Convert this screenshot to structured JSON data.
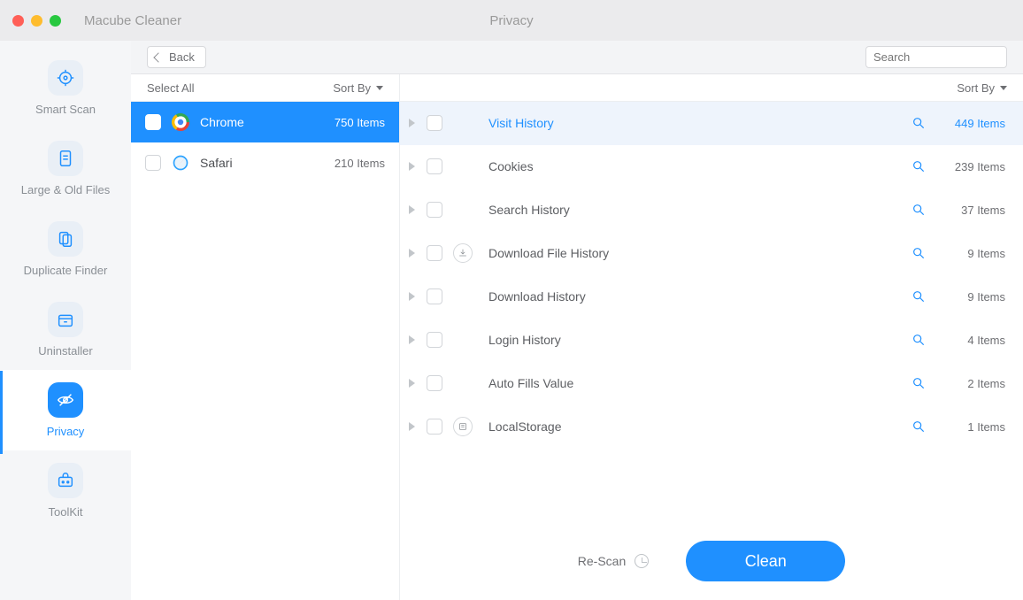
{
  "titlebar": {
    "app_name": "Macube Cleaner",
    "section": "Privacy"
  },
  "toolbar": {
    "back_label": "Back",
    "search_placeholder": "Search"
  },
  "sidebar": {
    "items": [
      {
        "label": "Smart Scan",
        "icon": "target-icon"
      },
      {
        "label": "Large & Old Files",
        "icon": "file-icon"
      },
      {
        "label": "Duplicate Finder",
        "icon": "copy-icon"
      },
      {
        "label": "Uninstaller",
        "icon": "archive-icon"
      },
      {
        "label": "Privacy",
        "icon": "eye-off-icon"
      },
      {
        "label": "ToolKit",
        "icon": "toolbox-icon"
      }
    ],
    "active_index": 4
  },
  "left_column": {
    "select_all": "Select All",
    "sort_by": "Sort By",
    "browsers": [
      {
        "name": "Chrome",
        "count": "750 Items",
        "icon": "chrome-icon",
        "selected": true
      },
      {
        "name": "Safari",
        "count": "210 Items",
        "icon": "safari-icon",
        "selected": false
      }
    ]
  },
  "right_column": {
    "sort_by": "Sort By",
    "rows": [
      {
        "name": "Visit History",
        "count": "449 Items",
        "highlight": true,
        "row_icon": null
      },
      {
        "name": "Cookies",
        "count": "239 Items",
        "highlight": false,
        "row_icon": null
      },
      {
        "name": "Search History",
        "count": "37 Items",
        "highlight": false,
        "row_icon": null
      },
      {
        "name": "Download File History",
        "count": "9 Items",
        "highlight": false,
        "row_icon": "download-icon"
      },
      {
        "name": "Download History",
        "count": "9 Items",
        "highlight": false,
        "row_icon": null
      },
      {
        "name": "Login History",
        "count": "4 Items",
        "highlight": false,
        "row_icon": null
      },
      {
        "name": "Auto Fills Value",
        "count": "2 Items",
        "highlight": false,
        "row_icon": null
      },
      {
        "name": "LocalStorage",
        "count": "1 Items",
        "highlight": false,
        "row_icon": "storage-icon"
      }
    ]
  },
  "footer": {
    "rescan": "Re-Scan",
    "clean": "Clean"
  }
}
